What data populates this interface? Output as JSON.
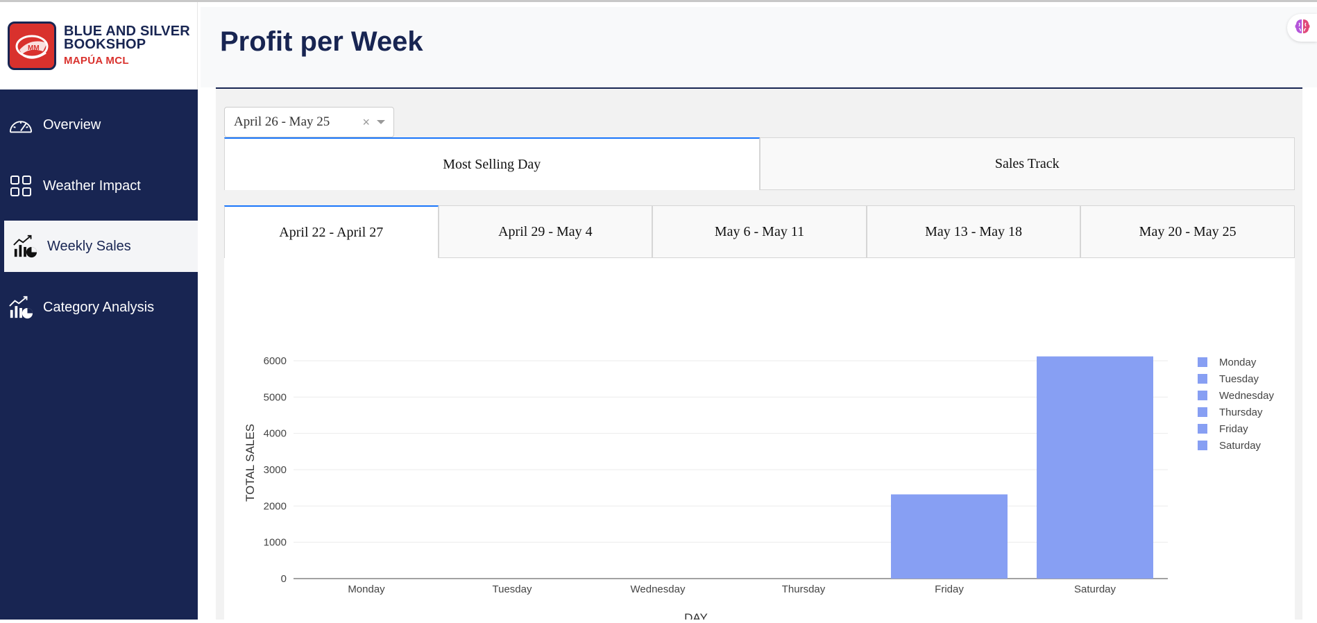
{
  "brand": {
    "name_line1": "BLUE AND SILVER",
    "name_line2": "BOOKSHOP",
    "subtitle": "MAPÚA MCL"
  },
  "sidebar": {
    "items": [
      {
        "label": "Overview",
        "icon": "speedometer-icon",
        "active": false
      },
      {
        "label": "Weather Impact",
        "icon": "grid-icon",
        "active": false
      },
      {
        "label": "Weekly Sales",
        "icon": "chart-growth-icon",
        "active": true
      },
      {
        "label": "Category Analysis",
        "icon": "chart-growth-icon",
        "active": false
      }
    ]
  },
  "header": {
    "title": "Profit per Week",
    "assistant_icon": "brain-icon"
  },
  "filter": {
    "selected": "April 26 - May 25",
    "clear_symbol": "×"
  },
  "view_tabs": [
    {
      "label": "Most Selling Day",
      "selected": true
    },
    {
      "label": "Sales Track",
      "selected": false
    }
  ],
  "week_tabs": [
    {
      "label": "April 22 - April 27",
      "selected": true
    },
    {
      "label": "April 29 - May 4",
      "selected": false
    },
    {
      "label": "May 6 - May 11",
      "selected": false
    },
    {
      "label": "May 13 - May 18",
      "selected": false
    },
    {
      "label": "May 20 - May 25",
      "selected": false
    }
  ],
  "colors": {
    "navy": "#182552",
    "accent_red": "#d9312d",
    "bar": "#879ff3",
    "tab_highlight": "#1975fa"
  },
  "chart_data": {
    "type": "bar",
    "title": "",
    "xlabel": "DAY",
    "ylabel": "TOTAL SALES",
    "categories": [
      "Monday",
      "Tuesday",
      "Wednesday",
      "Thursday",
      "Friday",
      "Saturday"
    ],
    "values": [
      0,
      0,
      0,
      0,
      2320,
      6120
    ],
    "ylim": [
      0,
      6000
    ],
    "yticks": [
      0,
      1000,
      2000,
      3000,
      4000,
      5000,
      6000
    ],
    "legend": [
      "Monday",
      "Tuesday",
      "Wednesday",
      "Thursday",
      "Friday",
      "Saturday"
    ],
    "legend_position": "right",
    "grid": true
  }
}
